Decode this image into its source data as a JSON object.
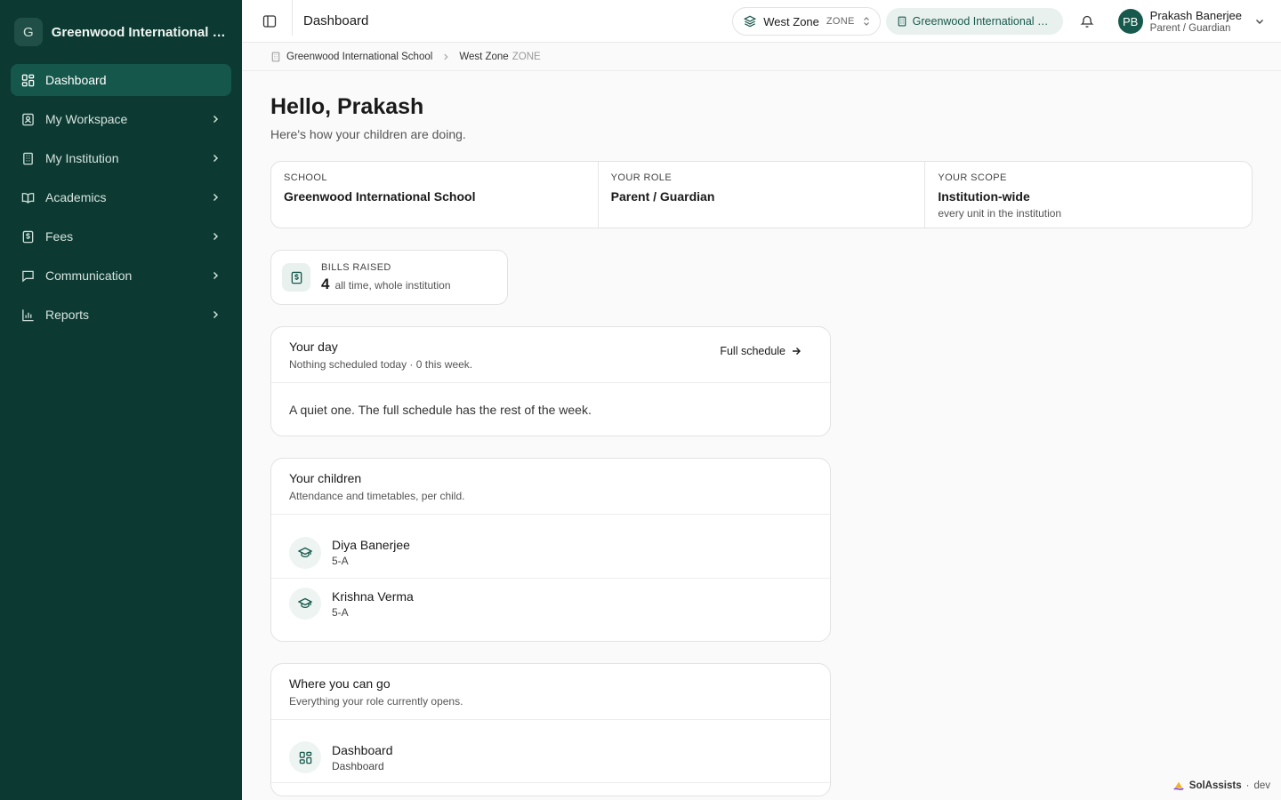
{
  "sidebar": {
    "brand_initial": "G",
    "brand_name": "Greenwood International School",
    "items": [
      {
        "label": "Dashboard"
      },
      {
        "label": "My Workspace"
      },
      {
        "label": "My Institution"
      },
      {
        "label": "Academics"
      },
      {
        "label": "Fees"
      },
      {
        "label": "Communication"
      },
      {
        "label": "Reports"
      }
    ]
  },
  "topbar": {
    "title": "Dashboard",
    "zone_name": "West Zone",
    "zone_tag": "ZONE",
    "school": "Greenwood International School",
    "user_initials": "PB",
    "user_name": "Prakash Banerjee",
    "user_role": "Parent / Guardian"
  },
  "breadcrumb": {
    "school": "Greenwood International School",
    "zone": "West Zone",
    "zone_tag": "ZONE"
  },
  "greeting": {
    "title": "Hello, Prakash",
    "subtitle": "Here's how your children are doing."
  },
  "info": {
    "school_label": "SCHOOL",
    "school_value": "Greenwood International School",
    "role_label": "YOUR ROLE",
    "role_value": "Parent / Guardian",
    "scope_label": "YOUR SCOPE",
    "scope_value": "Institution-wide",
    "scope_sub": "every unit in the institution"
  },
  "stat": {
    "label": "BILLS RAISED",
    "value": "4",
    "desc": "all time, whole institution"
  },
  "your_day": {
    "title": "Your day",
    "subtitle": "Nothing scheduled today · 0 this week.",
    "link": "Full schedule",
    "body": "A quiet one. The full schedule has the rest of the week."
  },
  "children": {
    "title": "Your children",
    "subtitle": "Attendance and timetables, per child.",
    "items": [
      {
        "name": "Diya Banerjee",
        "class": "5-A"
      },
      {
        "name": "Krishna Verma",
        "class": "5-A"
      }
    ]
  },
  "where": {
    "title": "Where you can go",
    "subtitle": "Everything your role currently opens.",
    "items": [
      {
        "name": "Dashboard",
        "sub": "Dashboard"
      }
    ]
  },
  "footer": {
    "brand": "SolAssists",
    "sep": "·",
    "env": "dev"
  },
  "colors": {
    "sidebar_bg": "#0c3a32",
    "active_item": "#15574b",
    "accent": "#17594c"
  }
}
